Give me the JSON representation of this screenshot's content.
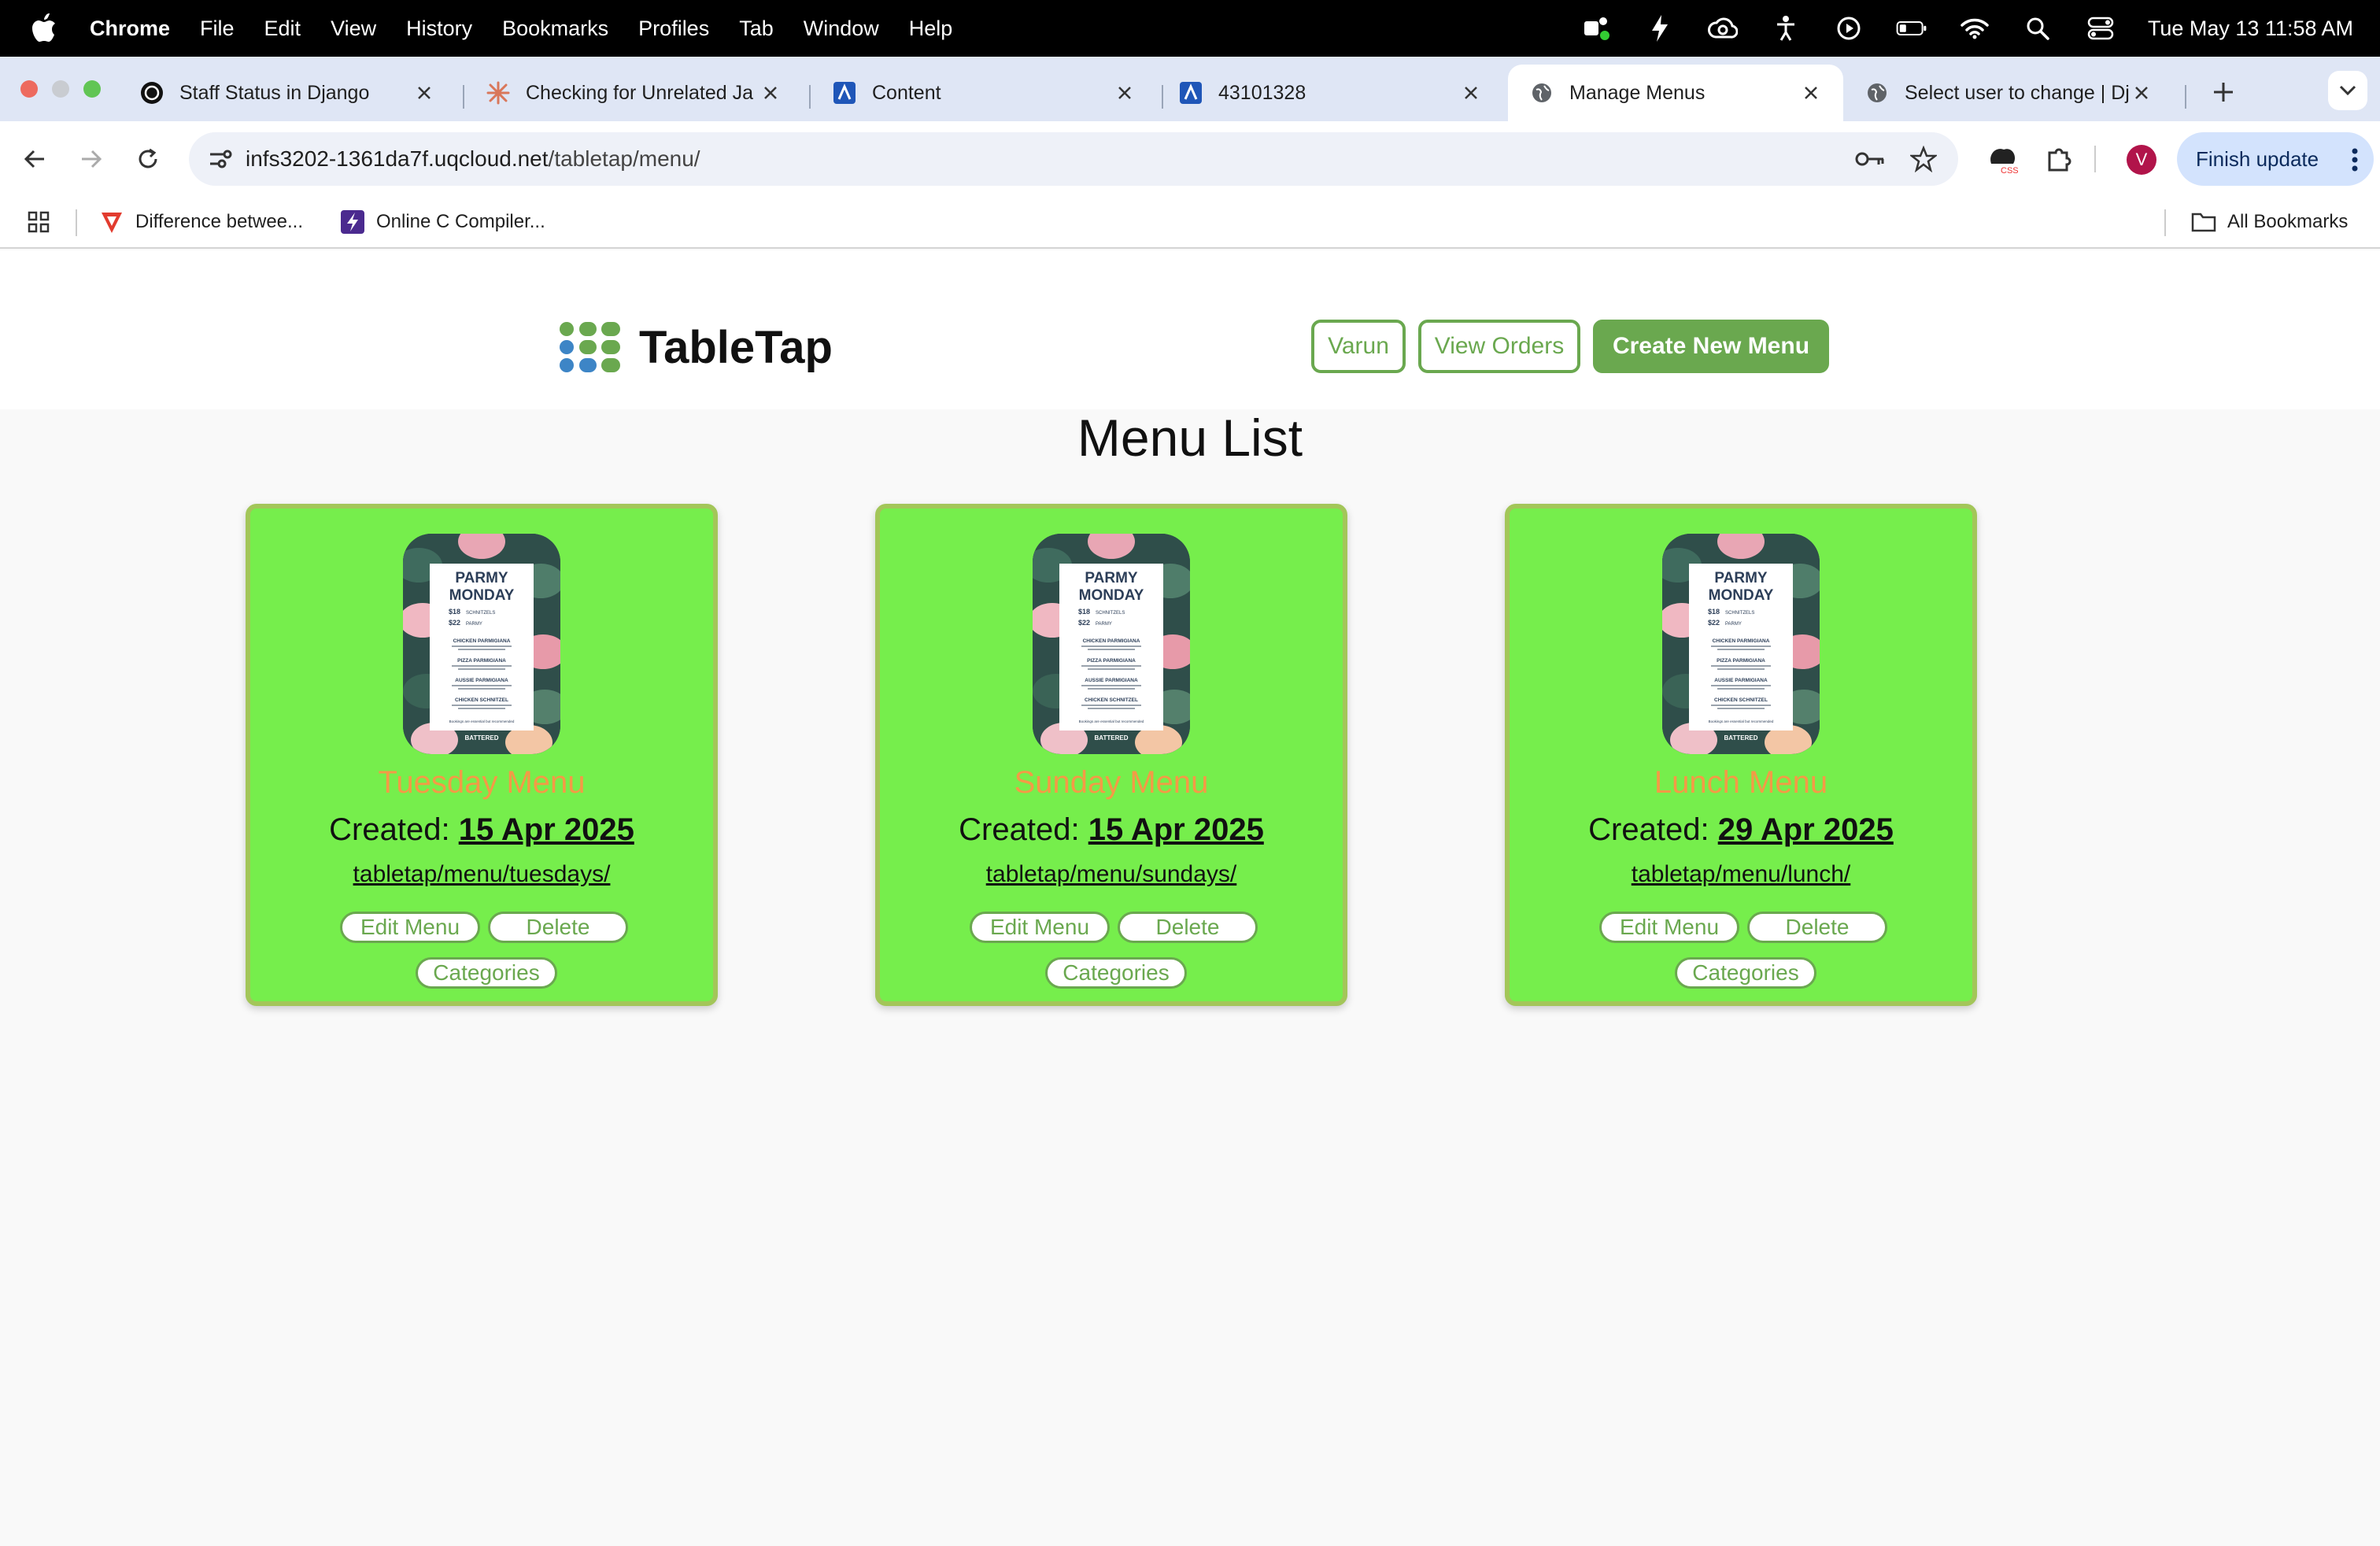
{
  "menubar": {
    "app": "Chrome",
    "items": [
      "File",
      "Edit",
      "View",
      "History",
      "Bookmarks",
      "Profiles",
      "Tab",
      "Window",
      "Help"
    ],
    "clock": "Tue May 13  11:58 AM"
  },
  "tabs": [
    {
      "title": "Staff Status in Django",
      "icon": "chatgpt-icon"
    },
    {
      "title": "Checking for Unrelated Ja",
      "icon": "claude-icon"
    },
    {
      "title": "Content",
      "icon": "app-a-icon"
    },
    {
      "title": "43101328",
      "icon": "app-a-icon"
    },
    {
      "title": "Manage Menus",
      "icon": "globe-icon",
      "active": true
    },
    {
      "title": "Select user to change | Dj",
      "icon": "globe-icon"
    }
  ],
  "toolbar": {
    "url_host": "infs3202-1361da7f.uqcloud.net",
    "url_path": "/tabletap/menu/",
    "finish_update": "Finish update",
    "avatar_initial": "V"
  },
  "bookmarks": {
    "items": [
      "Difference betwee...",
      "Online C Compiler..."
    ],
    "all": "All Bookmarks"
  },
  "site": {
    "brand": "TableTap",
    "user_button": "Varun",
    "orders_button": "View Orders",
    "create_button": "Create New Menu",
    "page_title": "Menu List",
    "colors": {
      "accent": "#6aa84f",
      "card": "#76ee4c",
      "menu_name": "#f49a46"
    }
  },
  "menus": [
    {
      "name": "Tuesday Menu",
      "created_label": "Created: ",
      "created": "15 Apr 2025",
      "link": "tabletap/menu/tuesdays/",
      "edit": "Edit Menu",
      "delete": "Delete",
      "categories": "Categories"
    },
    {
      "name": "Sunday Menu",
      "created_label": "Created: ",
      "created": "15 Apr 2025",
      "link": "tabletap/menu/sundays/",
      "edit": "Edit Menu",
      "delete": "Delete",
      "categories": "Categories"
    },
    {
      "name": "Lunch Menu",
      "created_label": "Created: ",
      "created": "29 Apr 2025",
      "link": "tabletap/menu/lunch/",
      "edit": "Edit Menu",
      "delete": "Delete",
      "categories": "Categories"
    }
  ],
  "thumbnail": {
    "heading1": "PARMY",
    "heading2": "MONDAY",
    "price1": "$18",
    "label1": "SCHNITZELS",
    "price2": "$22",
    "label2": "PARMY",
    "items": [
      "CHICKEN PARMIGIANA",
      "PIZZA PARMIGIANA",
      "AUSSIE PARMIGIANA",
      "CHICKEN SCHNITZEL"
    ],
    "footer": "Bookings are essential but recommended",
    "brand": "BATTERED"
  }
}
